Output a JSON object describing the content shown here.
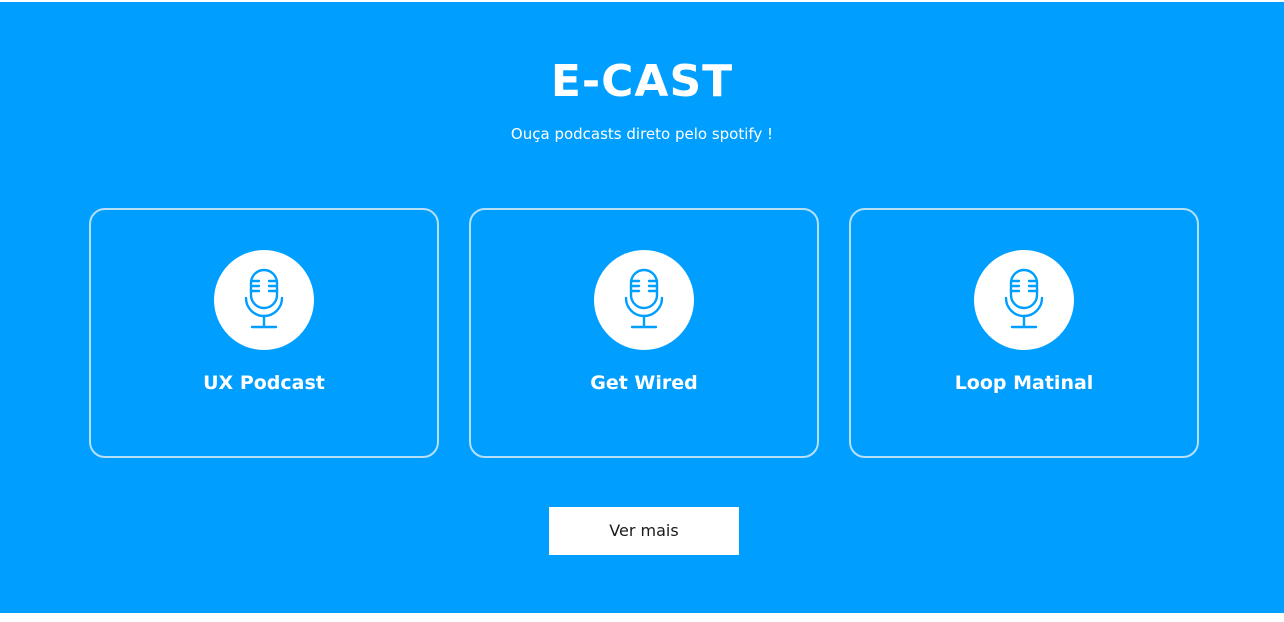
{
  "header": {
    "title": "E-CAST",
    "subtitle": "Ouça podcasts direto pelo spotify !"
  },
  "cards": [
    {
      "label": "UX Podcast",
      "icon": "microphone-icon"
    },
    {
      "label": "Get Wired",
      "icon": "microphone-icon"
    },
    {
      "label": "Loop Matinal",
      "icon": "microphone-icon"
    }
  ],
  "actions": {
    "more_label": "Ver mais"
  },
  "colors": {
    "background": "#009fff",
    "card_border": "#b6dff8",
    "icon": "#009fff",
    "text": "#ffffff"
  }
}
